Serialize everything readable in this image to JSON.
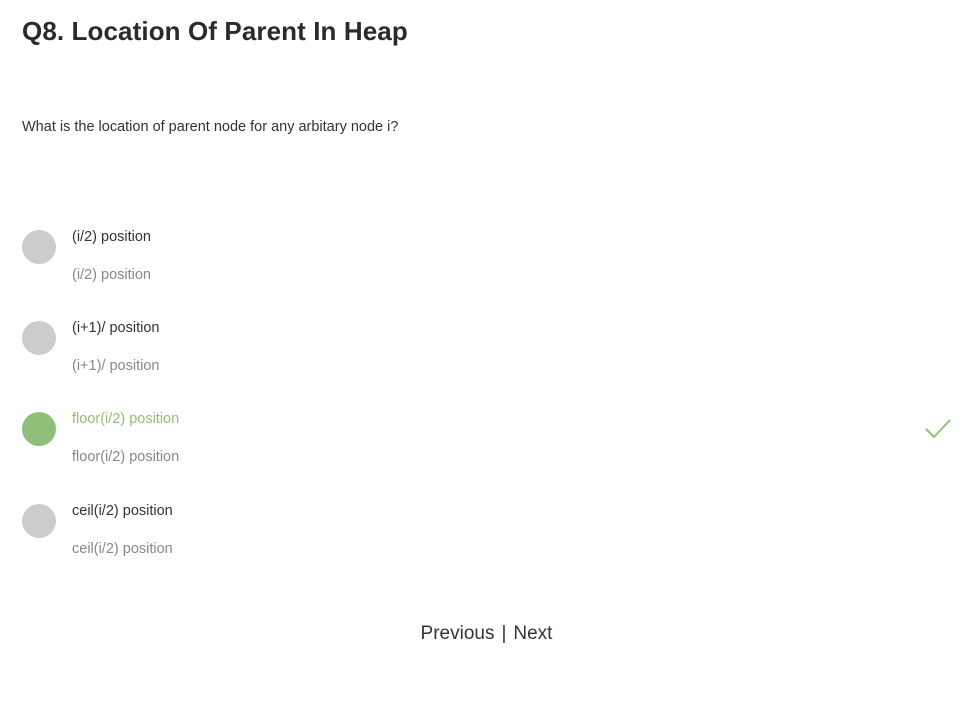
{
  "question": {
    "title": "Q8. Location Of Parent In Heap",
    "text": "What is the location of parent node for any arbitary node i?"
  },
  "options": [
    {
      "label": "(i/2) position",
      "sub": "(i/2) position",
      "correct": false
    },
    {
      "label": "(i+1)/ position",
      "sub": "(i+1)/ position",
      "correct": false
    },
    {
      "label": "floor(i/2) position",
      "sub": "floor(i/2) position",
      "correct": true
    },
    {
      "label": "ceil(i/2) position",
      "sub": "ceil(i/2) position",
      "correct": false
    }
  ],
  "pager": {
    "previous": "Previous",
    "separator": "|",
    "next": "Next"
  },
  "colors": {
    "correct": "#8ec07a",
    "unselected": "#cccccc"
  },
  "icons": {
    "correct_indicator": "check-icon"
  }
}
